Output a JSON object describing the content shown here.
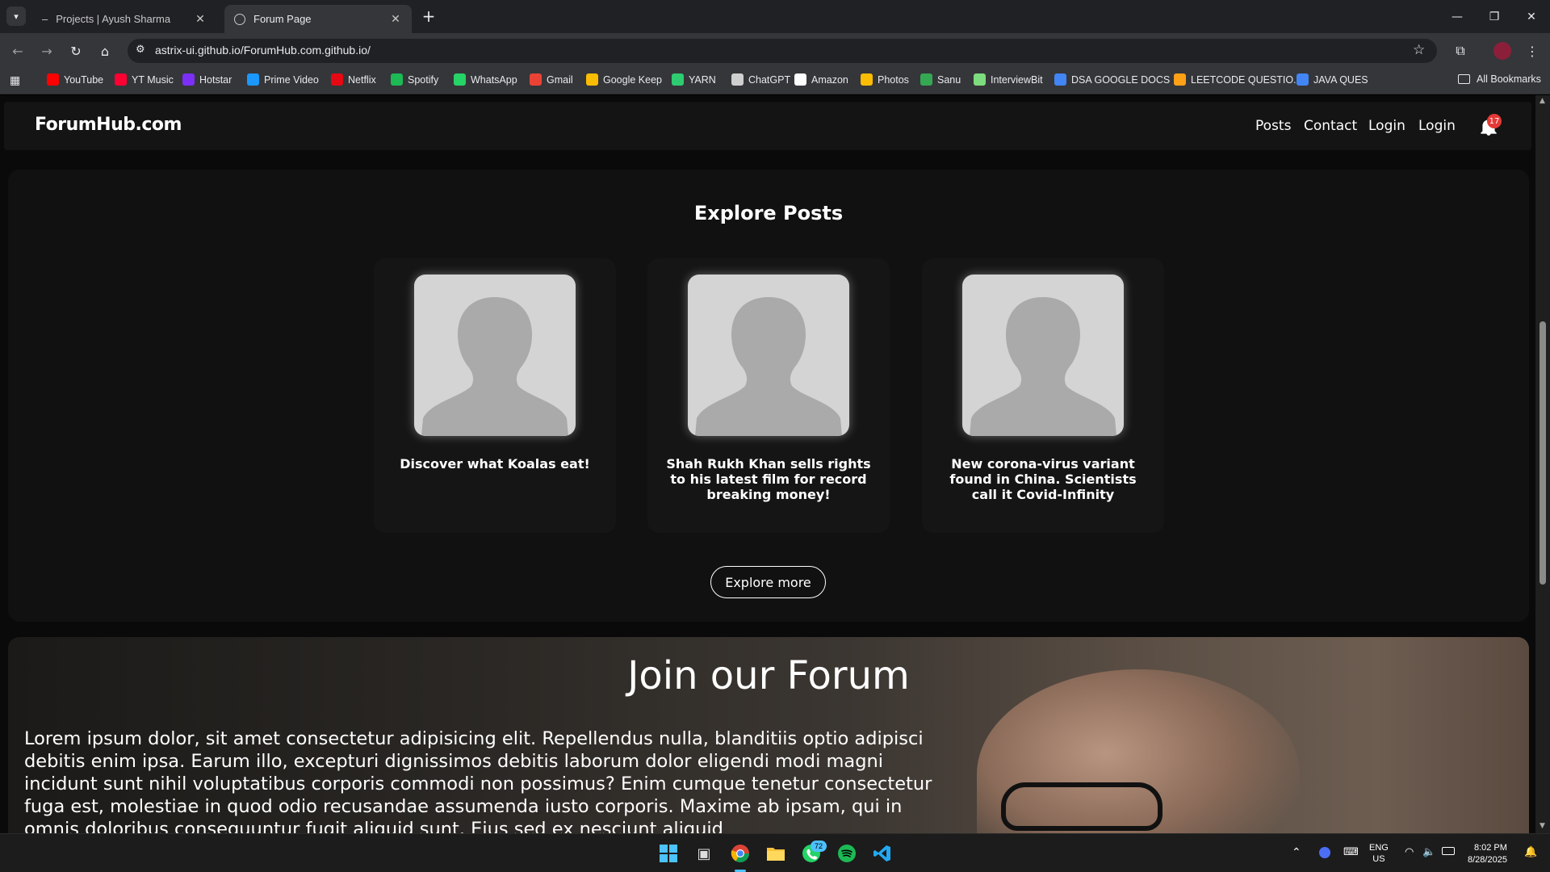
{
  "browser": {
    "tabs": [
      {
        "title": "Projects | Ayush Sharma",
        "active": false
      },
      {
        "title": "Forum Page",
        "active": true
      }
    ],
    "url": "astrix-ui.github.io/ForumHub.com.github.io/",
    "bookmarks": [
      {
        "label": "YouTube",
        "color": "#ff0000"
      },
      {
        "label": "YT Music",
        "color": "#ff0033"
      },
      {
        "label": "Hotstar",
        "color": "#7b2ff7"
      },
      {
        "label": "Prime Video",
        "color": "#1a98ff"
      },
      {
        "label": "Netflix",
        "color": "#e50914"
      },
      {
        "label": "Spotify",
        "color": "#1db954"
      },
      {
        "label": "WhatsApp",
        "color": "#25d366"
      },
      {
        "label": "Gmail",
        "color": "#ea4335"
      },
      {
        "label": "Google Keep",
        "color": "#fbbc04"
      },
      {
        "label": "YARN",
        "color": "#2ecc71"
      },
      {
        "label": "ChatGPT",
        "color": "#cfcfcf"
      },
      {
        "label": "Amazon",
        "color": "#ffffff"
      },
      {
        "label": "Photos",
        "color": "#fbbc04"
      },
      {
        "label": "Sanu",
        "color": "#34a853"
      },
      {
        "label": "InterviewBit",
        "color": "#7ddc7d"
      },
      {
        "label": "DSA GOOGLE DOCS",
        "color": "#4285f4"
      },
      {
        "label": "LEETCODE QUESTIO...",
        "color": "#ffa116"
      },
      {
        "label": "JAVA QUES",
        "color": "#4285f4"
      }
    ],
    "all_bookmarks": "All Bookmarks"
  },
  "site": {
    "brand": "ForumHub.com",
    "nav": [
      "Posts",
      "Contact",
      "Login",
      "Login"
    ],
    "notification_count": "17",
    "explore_title": "Explore Posts",
    "posts": [
      "Discover what Koalas eat!",
      "Shah Rukh Khan sells rights to his latest film for record breaking money!",
      "New corona-virus variant found in China. Scientists call it Covid-Infinity"
    ],
    "explore_more": "Explore more",
    "join_title": "Join our Forum",
    "join_text": "Lorem ipsum dolor, sit amet consectetur adipisicing elit. Repellendus nulla, blanditiis optio adipisci debitis enim ipsa. Earum illo, excepturi dignissimos debitis laborum dolor eligendi modi magni incidunt sunt nihil voluptatibus corporis commodi non possimus? Enim cumque tenetur consectetur fuga est, molestiae in quod odio recusandae assumenda iusto corporis. Maxime ab ipsam, qui in omnis doloribus consequuntur fugit aliquid sunt. Eius sed ex nesciunt aliquid"
  },
  "taskbar": {
    "whatsapp_badge": "72",
    "lang": "ENG",
    "region": "US",
    "time": "8:02 PM",
    "date": "8/28/2025"
  }
}
